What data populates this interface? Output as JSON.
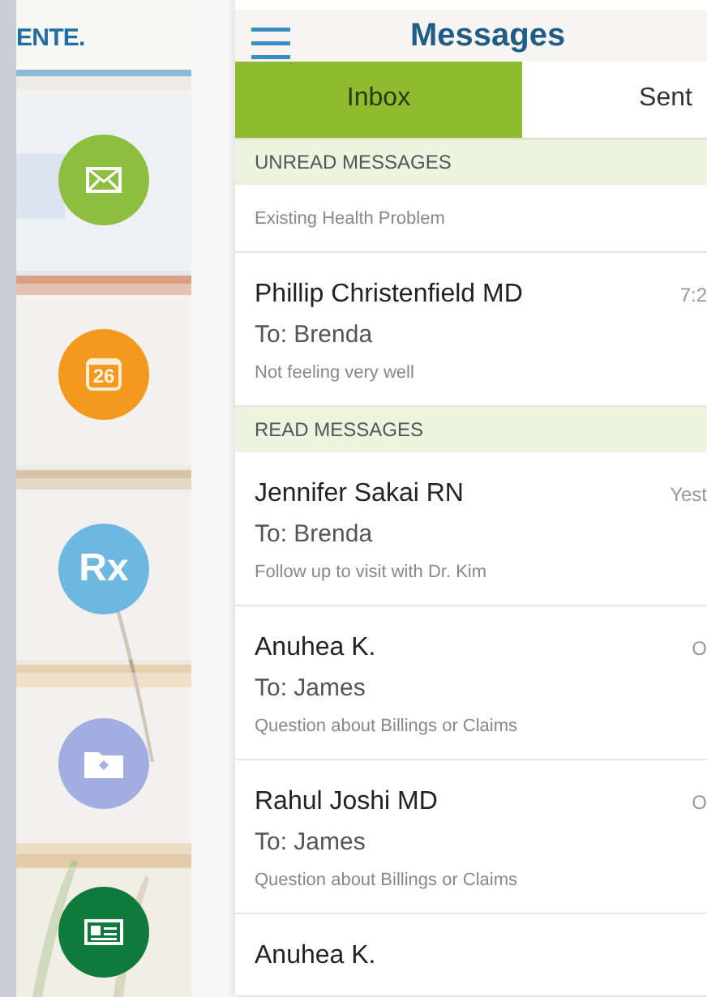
{
  "sidebar": {
    "logo": "ENTE.",
    "items": [
      {
        "kind": "mail",
        "color": "#8cbf3f"
      },
      {
        "kind": "calendar",
        "color": "#f39a1e",
        "text": "26"
      },
      {
        "kind": "rx",
        "color": "#6cb8e0",
        "text": "Rx"
      },
      {
        "kind": "folder",
        "color": "#a3aee0"
      },
      {
        "kind": "card",
        "color": "#0f7a3c"
      }
    ]
  },
  "header": {
    "title": "Messages"
  },
  "tabs": [
    {
      "label": "Inbox",
      "selected": true
    },
    {
      "label": "Sent",
      "selected": false
    }
  ],
  "sections": [
    {
      "title": "UNREAD MESSAGES",
      "messages": [
        {
          "subject": "Existing Health Problem"
        },
        {
          "sender": "Phillip Christenfield MD",
          "time": "7:2",
          "to": "To: Brenda",
          "subject": "Not feeling very well"
        }
      ]
    },
    {
      "title": "READ MESSAGES",
      "messages": [
        {
          "sender": "Jennifer Sakai RN",
          "time": "Yest",
          "to": "To: Brenda",
          "subject": "Follow up to visit with Dr. Kim"
        },
        {
          "sender": "Anuhea K.",
          "time": "O",
          "to": "To: James",
          "subject": "Question about Billings or Claims"
        },
        {
          "sender": "Rahul Joshi MD",
          "time": "O",
          "to": "To: James",
          "subject": "Question about Billings or Claims"
        },
        {
          "sender": "Anuhea K."
        }
      ]
    }
  ]
}
